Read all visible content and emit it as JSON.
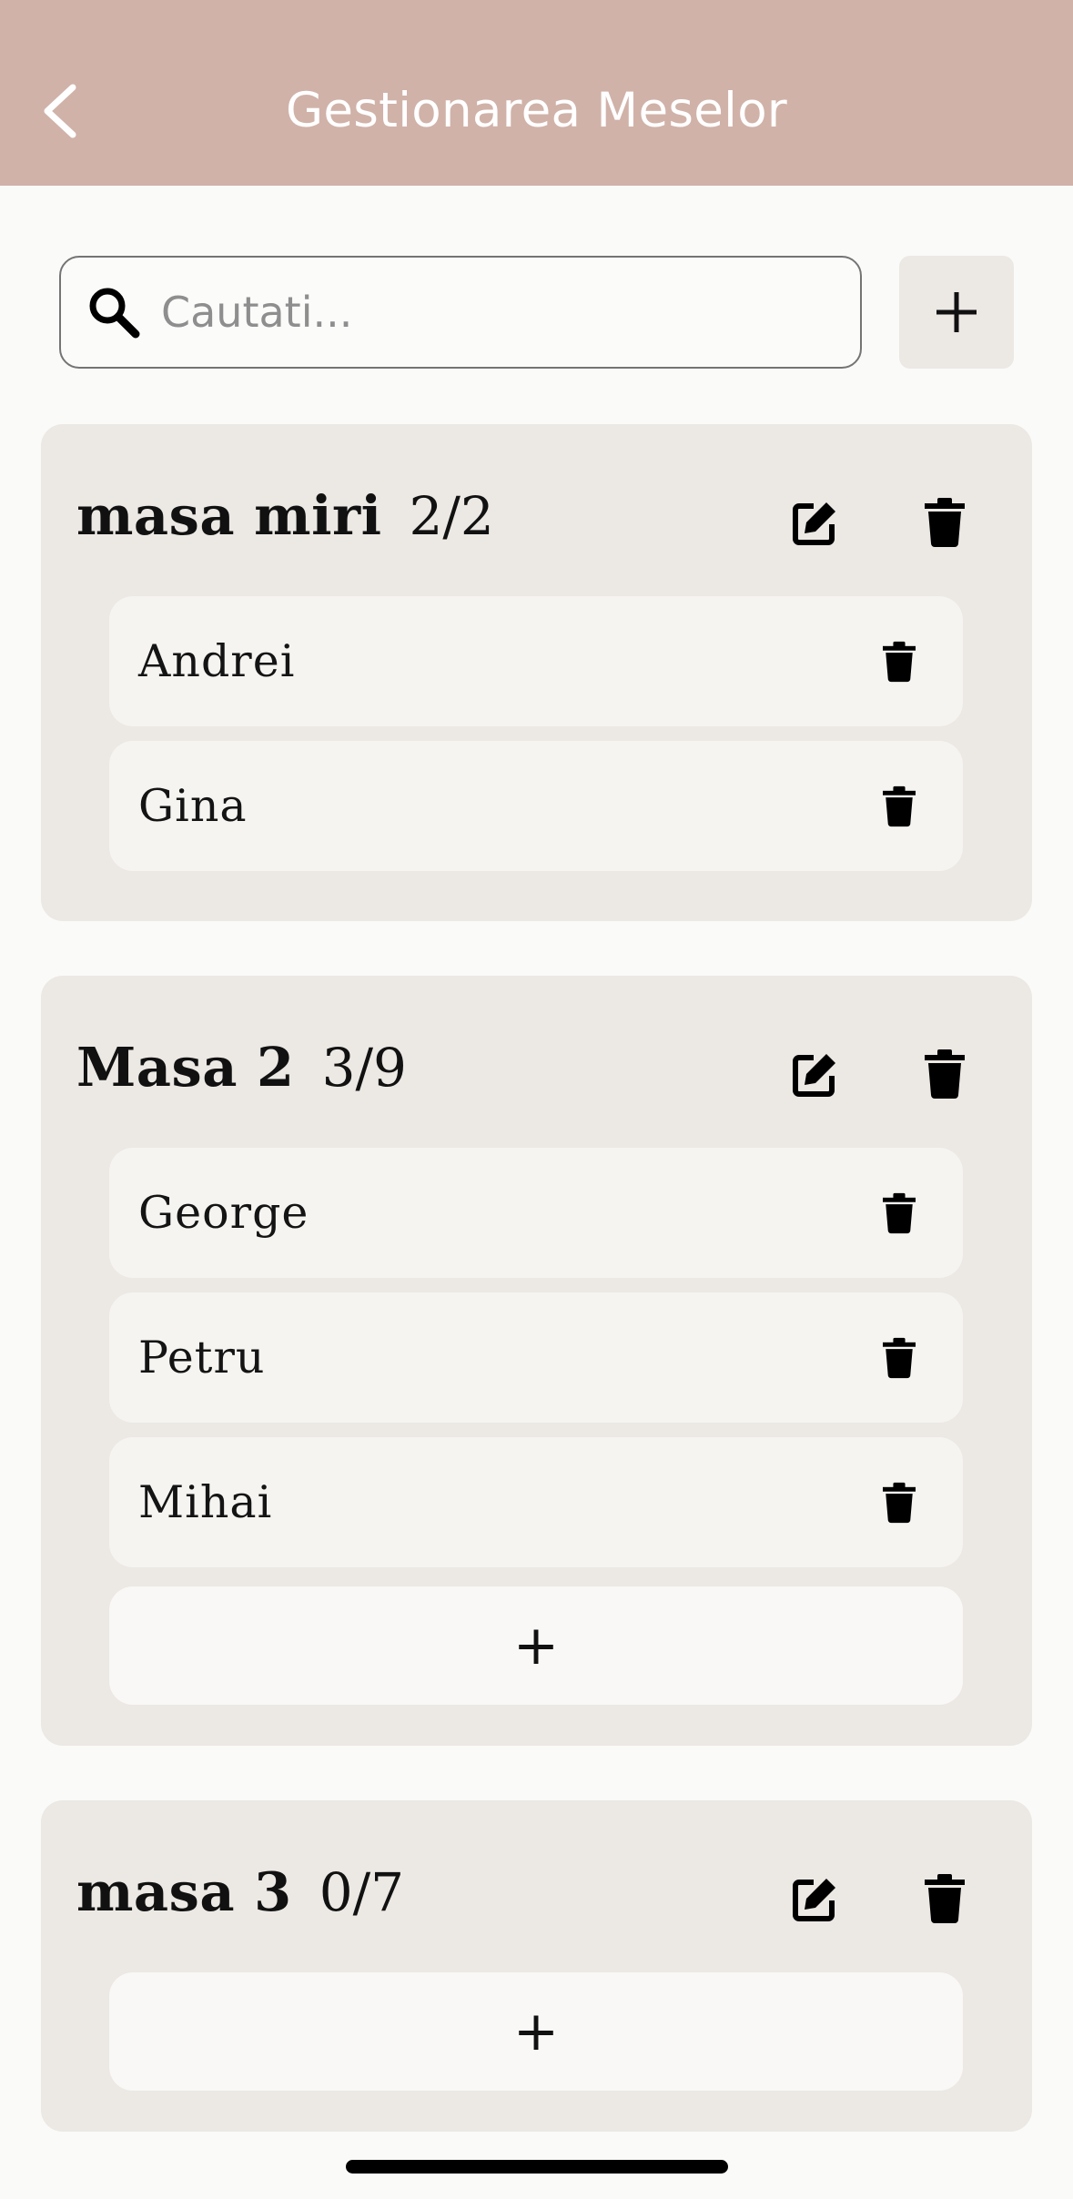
{
  "header": {
    "title": "Gestionarea Meselor",
    "back_icon": "chevron-left-icon"
  },
  "search": {
    "placeholder": "Cautati...",
    "value": "",
    "icon": "search-icon"
  },
  "toolbar": {
    "add_table_label": "+"
  },
  "tables": [
    {
      "name": "masa miri",
      "count": "2/2",
      "guests": [
        "Andrei",
        "Gina"
      ],
      "add_label": null
    },
    {
      "name": "Masa 2",
      "count": "3/9",
      "guests": [
        "George",
        "Petru",
        "Mihai"
      ],
      "add_label": "+"
    },
    {
      "name": "masa 3",
      "count": "0/7",
      "guests": [],
      "add_label": "+"
    }
  ],
  "colors": {
    "appbar": "#d0b2a9",
    "background": "#fafaf9",
    "card": "#ece8e4",
    "guest_row": "#f5f4f1"
  }
}
